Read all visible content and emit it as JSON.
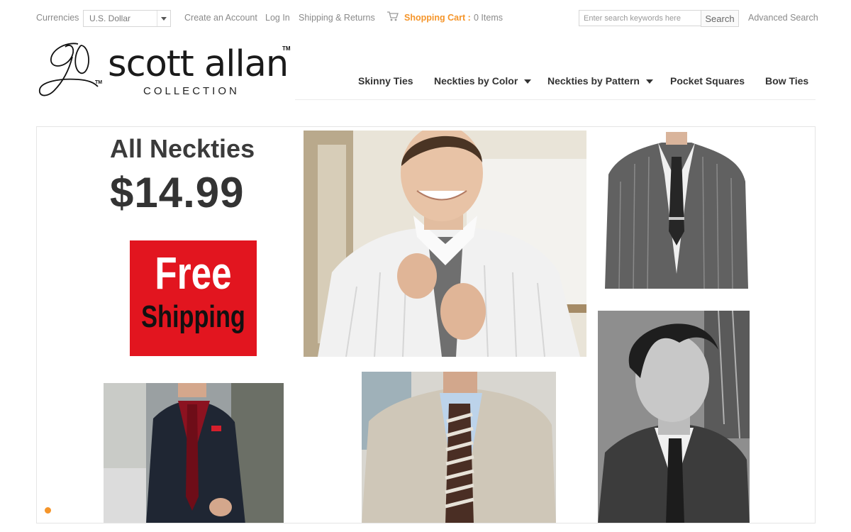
{
  "topbar": {
    "currencies_label": "Currencies",
    "currency_value": "U.S. Dollar",
    "create_account": "Create an Account",
    "login": "Log In",
    "shipping_returns": "Shipping & Returns",
    "cart_label": "Shopping Cart :",
    "cart_count": "0 Items",
    "search_placeholder": "Enter search keywords here",
    "search_button": "Search",
    "advanced_search": "Advanced Search"
  },
  "logo": {
    "wordmark": "scott allan",
    "trademark": "TM",
    "monogram_trademark": "TM",
    "subtitle": "COLLECTION"
  },
  "nav": {
    "items": [
      {
        "label": "Skinny Ties"
      },
      {
        "label": "Neckties by Color"
      },
      {
        "label": "Neckties by Pattern"
      },
      {
        "label": "Pocket Squares"
      },
      {
        "label": "Bow Ties"
      }
    ]
  },
  "hero": {
    "promo_title": "All Neckties",
    "promo_price": "$14.99",
    "free_line1": "Free",
    "free_line2": "Shipping"
  },
  "colors": {
    "accent_orange": "#f5952a",
    "promo_red": "#e2151f",
    "nav_text": "#333333",
    "utility_text": "#8a8a8a"
  },
  "icons": {
    "cart": "shopping-cart-icon",
    "dropdown": "chevron-down-icon"
  }
}
